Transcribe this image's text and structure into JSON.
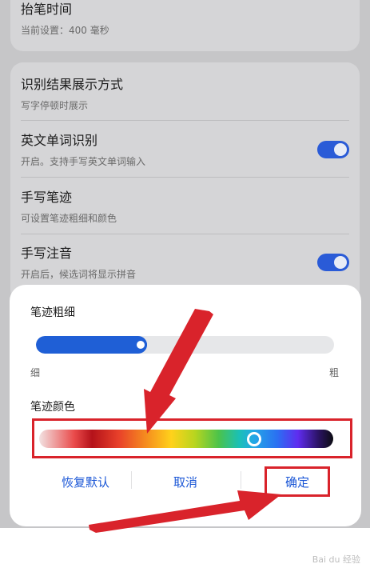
{
  "settings": {
    "pen_lift": {
      "title": "抬笔时间",
      "subtitle": "当前设置：400 毫秒"
    },
    "result_display": {
      "title": "识别结果展示方式",
      "subtitle": "写字停顿时展示"
    },
    "english_words": {
      "title": "英文单词识别",
      "subtitle": "开启。支持手写英文单词输入",
      "enabled": true
    },
    "stroke": {
      "title": "手写笔迹",
      "subtitle": "可设置笔迹粗细和颜色"
    },
    "pinyin": {
      "title": "手写注音",
      "subtitle": "开启后，候选词将显示拼音",
      "enabled": true
    }
  },
  "sheet": {
    "thickness_label": "笔迹粗细",
    "thin_label": "细",
    "thick_label": "粗",
    "thickness_value": 0.35,
    "color_label": "笔迹颜色",
    "color_position": 0.73,
    "buttons": {
      "reset": "恢复默认",
      "cancel": "取消",
      "confirm": "确定"
    }
  },
  "colors": {
    "accent": "#1f5fd6",
    "annotation_red": "#d9232b"
  },
  "watermark": "Bai du 经验"
}
